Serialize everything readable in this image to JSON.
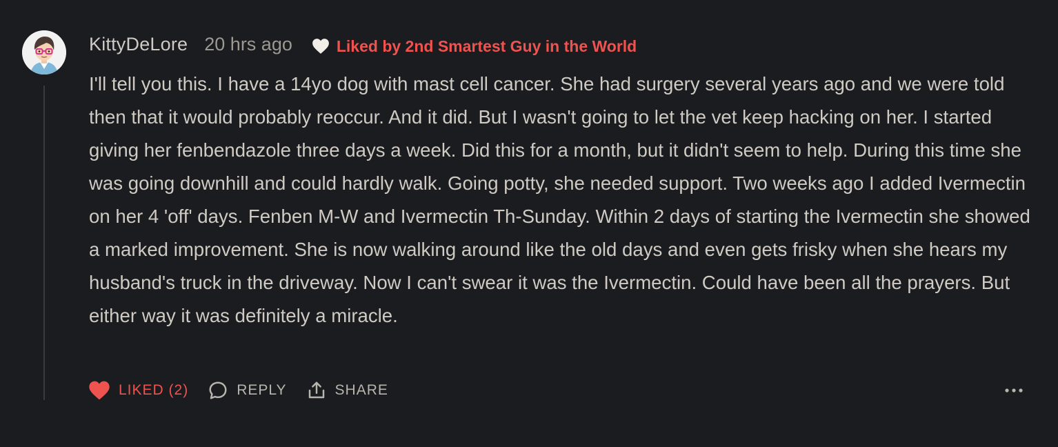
{
  "comment": {
    "author": "KittyDeLore",
    "timestamp": "20 hrs ago",
    "liked_by": "Liked by 2nd Smartest Guy in the World",
    "body": "I'll tell you this. I have a 14yo dog with mast cell cancer. She had surgery several years ago and we were told then that it would probably reoccur. And it did. But I wasn't going to let the vet keep hacking on her. I started giving her fenbendazole three days a week. Did this for a month, but it didn't seem to help. During this time she was going downhill and could hardly walk. Going potty, she needed support. Two weeks ago I added Ivermectin on her 4 'off' days. Fenben M-W and Ivermectin Th-Sunday. Within 2 days of starting the Ivermectin she showed a marked improvement. She is now walking around like the old days and even gets frisky when she hears my husband's truck in the driveway. Now I can't swear it was the Ivermectin. Could have been all the prayers. But either way it was definitely a miracle."
  },
  "actions": {
    "like_label": "LIKED (2)",
    "reply_label": "REPLY",
    "share_label": "SHARE"
  },
  "icons": {
    "avatar": "cartoon-avatar-icon",
    "liked_by": "heart-outline-icon",
    "like": "heart-filled-icon",
    "reply": "speech-bubble-icon",
    "share": "share-upload-icon",
    "more": "ellipsis-icon"
  },
  "colors": {
    "background": "#1b1c1f",
    "text": "#cfcac3",
    "muted": "#9c9892",
    "accent": "#ef5350"
  }
}
